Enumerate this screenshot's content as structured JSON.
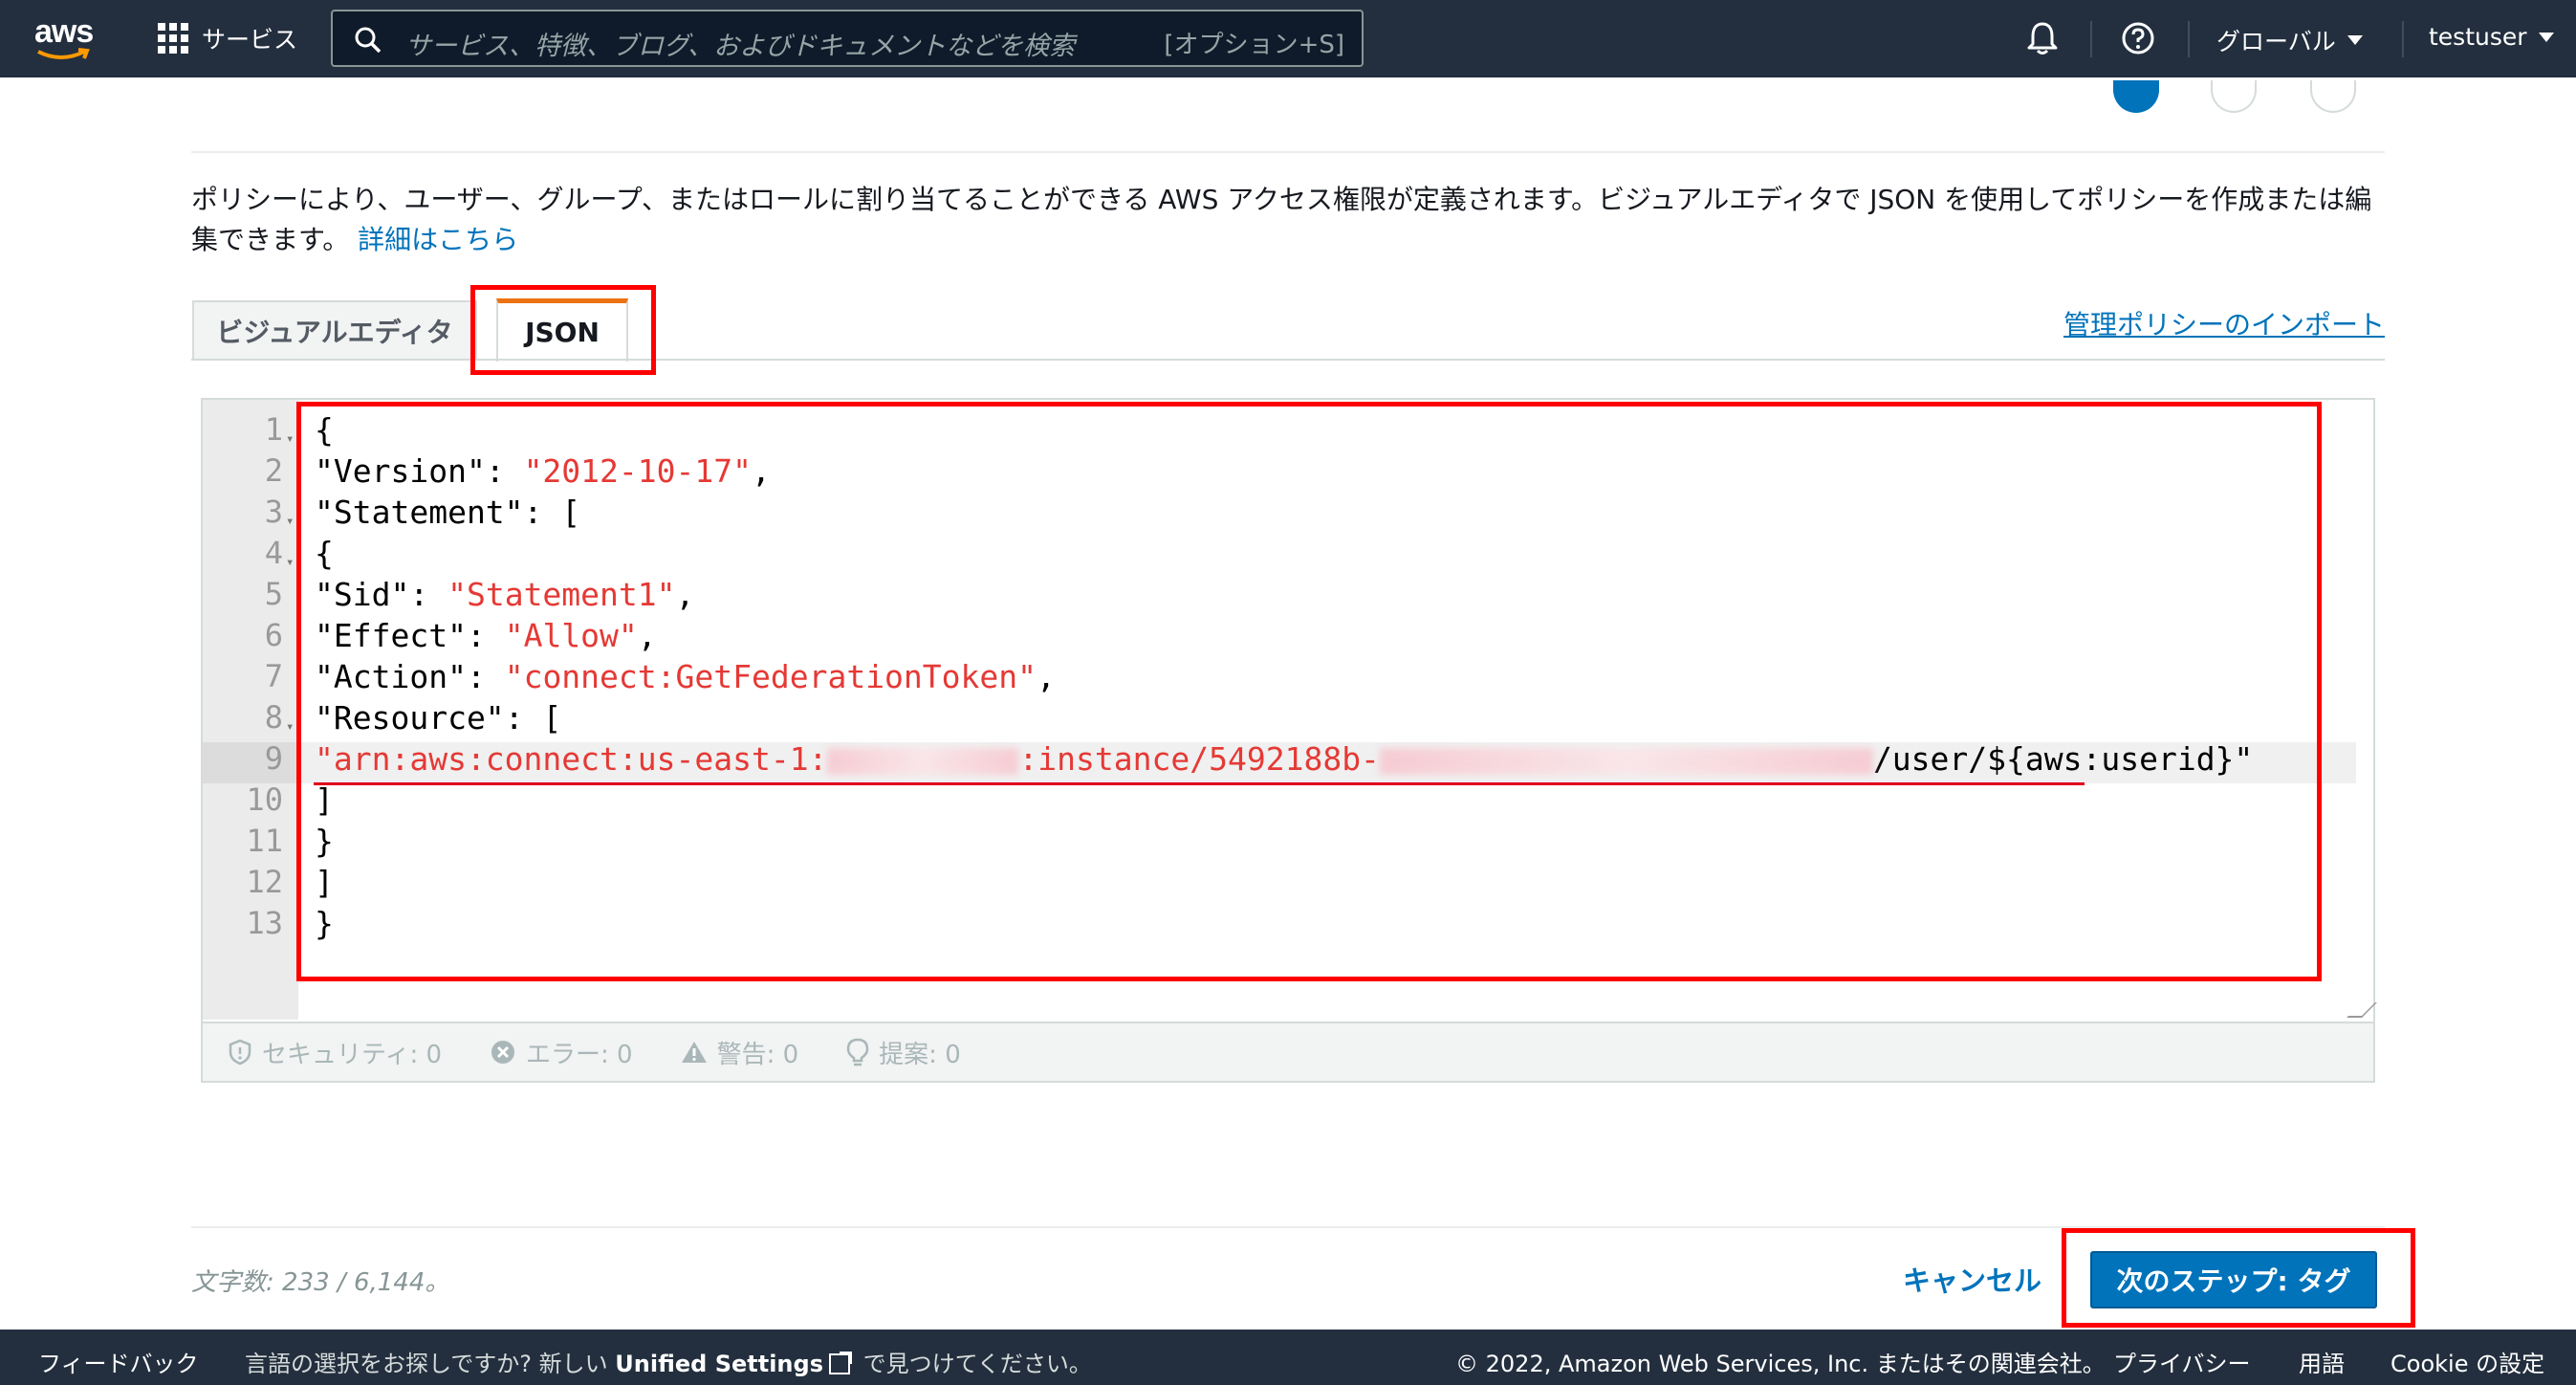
{
  "colors": {
    "nav_bg": "#232f3e",
    "link": "#0073bb",
    "primary_button": "#0073bb",
    "tab_accent": "#ec7211",
    "json_string": "#e53935",
    "annotation": "#ff0000"
  },
  "topnav": {
    "logo_text": "aws",
    "services_label": "サービス",
    "search_placeholder": "サービス、特徴、ブログ、およびドキュメントなどを検索",
    "search_shortcut": "[オプション+S]",
    "region_label": "グローバル",
    "user_label": "testuser",
    "icons": [
      "grid-icon",
      "search-icon",
      "bell-icon",
      "help-icon",
      "caret-down-icon"
    ]
  },
  "description": {
    "text": "ポリシーにより、ユーザー、グループ、またはロールに割り当てることができる AWS アクセス権限が定義されます。ビジュアルエディタで JSON を使用してポリシーを作成または編集できます。",
    "link": "詳細はこちら"
  },
  "tabs": {
    "visual": "ビジュアルエディタ",
    "json": "JSON",
    "active": "JSON"
  },
  "import_link": "管理ポリシーのインポート",
  "editor": {
    "lines": [
      {
        "n": "1",
        "fold": true
      },
      {
        "n": "2",
        "key": "\"Version\"",
        "sep": ": ",
        "value": "\"2012-10-17\"",
        "end": ","
      },
      {
        "n": "3",
        "fold": true,
        "key": "\"Statement\"",
        "sep": ": ",
        "end": "["
      },
      {
        "n": "4",
        "fold": true
      },
      {
        "n": "5",
        "key": "\"Sid\"",
        "sep": ": ",
        "value": "\"Statement1\"",
        "end": ","
      },
      {
        "n": "6",
        "key": "\"Effect\"",
        "sep": ": ",
        "value": "\"Allow\"",
        "end": ","
      },
      {
        "n": "7",
        "key": "\"Action\"",
        "sep": ": ",
        "value": "\"connect:GetFederationToken\"",
        "end": ","
      },
      {
        "n": "8",
        "fold": true,
        "key": "\"Resource\"",
        "sep": ": ",
        "end": "["
      },
      {
        "n": "9",
        "arn_prefix": "\"arn:aws:connect:us-east-1:",
        "arn_mid": ":instance/5492188b-",
        "arn_suffix": "/user/${aws:userid}\""
      },
      {
        "n": "10",
        "end": "]"
      },
      {
        "n": "11",
        "end": "}"
      },
      {
        "n": "12",
        "end": "]"
      },
      {
        "n": "13",
        "end": "}"
      }
    ],
    "line1_text": "{",
    "line4_text": "{",
    "status": {
      "security": "セキュリティ: 0",
      "errors": "エラー: 0",
      "warnings": "警告: 0",
      "suggestions": "提案: 0"
    }
  },
  "footer_actions": {
    "char_count": "文字数: 233 / 6,144。",
    "cancel": "キャンセル",
    "next": "次のステップ: タグ"
  },
  "bottom_bar": {
    "feedback": "フィードバック",
    "lang_prefix": "言語の選択をお探しですか? 新しい",
    "unified_settings": "Unified Settings",
    "lang_suffix": "で見つけてください。",
    "copyright": "© 2022, Amazon Web Services, Inc. またはその関連会社。",
    "privacy": "プライバシー",
    "terms": "用語",
    "cookie": "Cookie の設定"
  }
}
